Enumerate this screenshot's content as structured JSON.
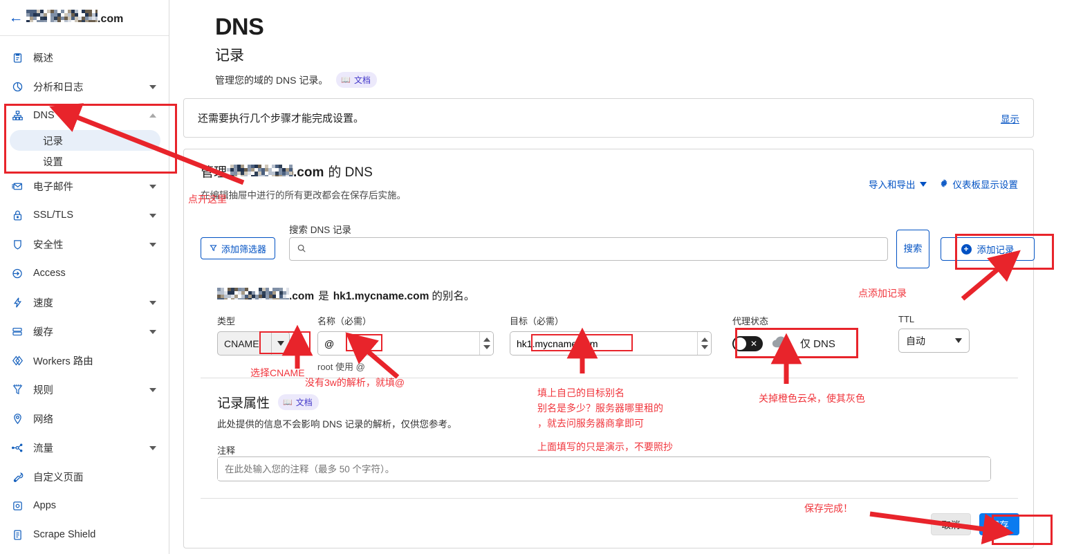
{
  "sidebar": {
    "back_icon": "arrow-left-icon",
    "domain_suffix": ".com",
    "items": [
      {
        "label": "概述",
        "icon": "clipboard-icon",
        "expandable": false
      },
      {
        "label": "分析和日志",
        "icon": "pie-chart-icon",
        "expandable": true
      },
      {
        "label": "DNS",
        "icon": "sitemap-icon",
        "expandable": true,
        "expanded": true,
        "children": [
          {
            "label": "记录",
            "active": true
          },
          {
            "label": "设置",
            "active": false
          }
        ]
      },
      {
        "label": "电子邮件",
        "icon": "envelope-icon",
        "expandable": true
      },
      {
        "label": "SSL/TLS",
        "icon": "lock-icon",
        "expandable": true
      },
      {
        "label": "安全性",
        "icon": "shield-icon",
        "expandable": true
      },
      {
        "label": "Access",
        "icon": "access-arrow-icon",
        "expandable": false
      },
      {
        "label": "速度",
        "icon": "bolt-icon",
        "expandable": true
      },
      {
        "label": "缓存",
        "icon": "database-icon",
        "expandable": true
      },
      {
        "label": "Workers 路由",
        "icon": "workers-icon",
        "expandable": false
      },
      {
        "label": "规则",
        "icon": "funnel-icon",
        "expandable": true
      },
      {
        "label": "网络",
        "icon": "pin-icon",
        "expandable": false
      },
      {
        "label": "流量",
        "icon": "traffic-icon",
        "expandable": true
      },
      {
        "label": "自定义页面",
        "icon": "wrench-icon",
        "expandable": false
      },
      {
        "label": "Apps",
        "icon": "app-square-icon",
        "expandable": false
      },
      {
        "label": "Scrape Shield",
        "icon": "document-icon",
        "expandable": false
      }
    ]
  },
  "page": {
    "title": "DNS",
    "subtitle": "记录",
    "description": "管理您的域的 DNS 记录。",
    "doc_badge": "文档",
    "doc_badge_icon": "book-icon"
  },
  "notice": {
    "text": "还需要执行几个步骤才能完成设置。",
    "link": "显示"
  },
  "dns_card": {
    "manage_prefix": "管理",
    "manage_domain_suffix": ".com",
    "manage_suffix": "的 DNS",
    "description": "在编辑抽屉中进行的所有更改都会在保存后实施。",
    "import_export": "导入和导出",
    "dashboard_settings": "仪表板显示设置",
    "dashboard_settings_icon": "gear-icon"
  },
  "search": {
    "filter_button": "添加筛选器",
    "filter_icon": "funnel-icon",
    "label": "搜索 DNS 记录",
    "placeholder": "",
    "search_icon": "search-icon",
    "search_button": "搜索",
    "add_record_button": "添加记录",
    "add_record_icon": "plus-circle-icon"
  },
  "record": {
    "alias_domain_suffix": ".com",
    "alias_is": "是",
    "alias_target": "hk1.mycname.com",
    "alias_suffix": "的别名。",
    "type_label": "类型",
    "type_value": "CNAME",
    "name_label": "名称（必需）",
    "name_value": "@",
    "name_hint": "root 使用 @",
    "target_label": "目标（必需）",
    "target_value": "hk1.mycname.com",
    "proxy_label": "代理状态",
    "proxy_status": "仅 DNS",
    "proxy_icon": "cloud-icon",
    "toggle_state": "off",
    "ttl_label": "TTL",
    "ttl_value": "自动"
  },
  "attributes": {
    "title": "记录属性",
    "doc_badge": "文档",
    "doc_badge_icon": "book-icon",
    "description": "此处提供的信息不会影响 DNS 记录的解析，仅供您参考。",
    "comment_label": "注释",
    "comment_placeholder": "在此处输入您的注释（最多 50 个字符）。"
  },
  "footer": {
    "cancel": "取消",
    "save": "保存"
  },
  "annotations": [
    {
      "id": "click-here",
      "text": "点开这里"
    },
    {
      "id": "click-add-record",
      "text": "点添加记录"
    },
    {
      "id": "choose-cname",
      "text": "选择CNAME"
    },
    {
      "id": "no-www-use-at",
      "text": "没有3w的解析，就填@"
    },
    {
      "id": "fill-target-1",
      "text": "填上自己的目标别名"
    },
    {
      "id": "fill-target-2",
      "text": "别名是多少？服务器哪里租的"
    },
    {
      "id": "fill-target-3",
      "text": "，就去问服务器商拿即可"
    },
    {
      "id": "turn-off-cloud",
      "text": "关掉橙色云朵，使其灰色"
    },
    {
      "id": "demo-only",
      "text": "上面填写的只是演示，不要照抄"
    },
    {
      "id": "save-done",
      "text": "保存完成！"
    }
  ],
  "colors": {
    "accent_blue": "#0051c3",
    "annotation_red": "#f0353c",
    "save_blue": "#0a7bf0",
    "badge_purple": "#4338ca",
    "active_sub_bg": "#e8eff9"
  }
}
